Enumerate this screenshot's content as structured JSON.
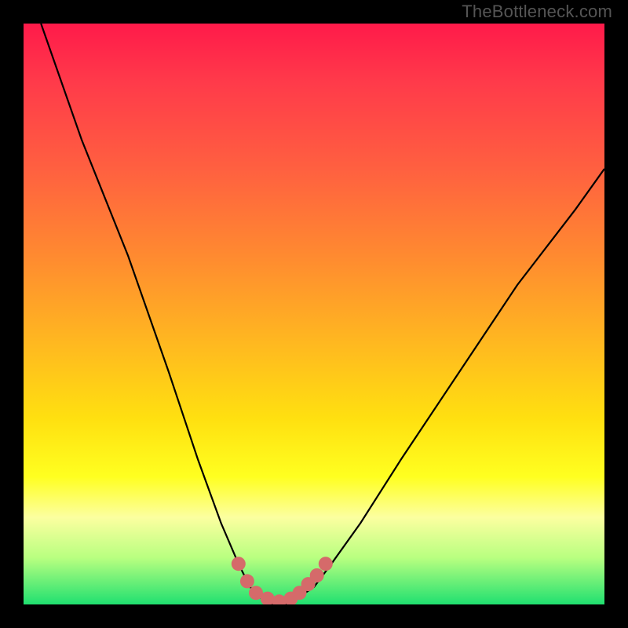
{
  "watermark": "TheBottleneck.com",
  "chart_data": {
    "type": "line",
    "title": "",
    "xlabel": "",
    "ylabel": "",
    "xlim": [
      0,
      100
    ],
    "ylim": [
      0,
      100
    ],
    "series": [
      {
        "name": "bottleneck-curve",
        "x": [
          3,
          10,
          18,
          25,
          30,
          34,
          37,
          39,
          41,
          43,
          45,
          47,
          50,
          53,
          58,
          65,
          75,
          85,
          95,
          100
        ],
        "values": [
          100,
          80,
          60,
          40,
          25,
          14,
          7,
          3,
          1,
          0,
          0,
          1,
          3,
          7,
          14,
          25,
          40,
          55,
          68,
          75
        ]
      }
    ],
    "markers": {
      "name": "highlight-dots",
      "x": [
        37,
        38.5,
        40,
        42,
        44,
        46,
        47.5,
        49,
        50.5,
        52
      ],
      "values": [
        7,
        4,
        2,
        1,
        0.5,
        1,
        2,
        3.5,
        5,
        7
      ]
    },
    "gradient_stops": [
      {
        "pct": 0,
        "color": "#ff1a4a"
      },
      {
        "pct": 10,
        "color": "#ff3a4a"
      },
      {
        "pct": 25,
        "color": "#ff6040"
      },
      {
        "pct": 40,
        "color": "#ff8a30"
      },
      {
        "pct": 55,
        "color": "#ffb820"
      },
      {
        "pct": 68,
        "color": "#ffe010"
      },
      {
        "pct": 78,
        "color": "#ffff20"
      },
      {
        "pct": 85,
        "color": "#fcffa0"
      },
      {
        "pct": 92,
        "color": "#b8ff80"
      },
      {
        "pct": 100,
        "color": "#20e070"
      }
    ],
    "marker_color": "#d56a6a",
    "curve_color": "#000000"
  }
}
